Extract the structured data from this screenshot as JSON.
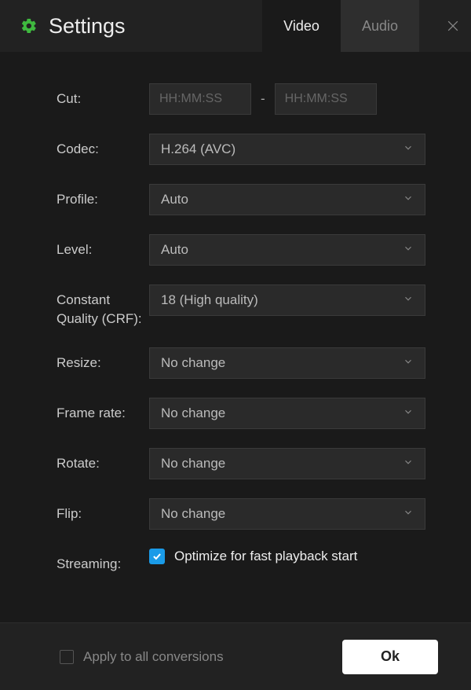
{
  "header": {
    "title": "Settings",
    "tabs": {
      "video": "Video",
      "audio": "Audio"
    }
  },
  "fields": {
    "cut": {
      "label": "Cut:",
      "placeholder_from": "HH:MM:SS",
      "placeholder_to": "HH:MM:SS"
    },
    "codec": {
      "label": "Codec:",
      "value": "H.264 (AVC)"
    },
    "profile": {
      "label": "Profile:",
      "value": "Auto"
    },
    "level": {
      "label": "Level:",
      "value": "Auto"
    },
    "crf": {
      "label": "Constant Quality (CRF):",
      "value": "18 (High quality)"
    },
    "resize": {
      "label": "Resize:",
      "value": "No change"
    },
    "framerate": {
      "label": "Frame rate:",
      "value": "No change"
    },
    "rotate": {
      "label": "Rotate:",
      "value": "No change"
    },
    "flip": {
      "label": "Flip:",
      "value": "No change"
    },
    "streaming": {
      "label": "Streaming:",
      "checkbox_label": "Optimize for fast playback start",
      "checked": true
    }
  },
  "footer": {
    "apply_all": "Apply to all conversions",
    "ok": "Ok"
  }
}
